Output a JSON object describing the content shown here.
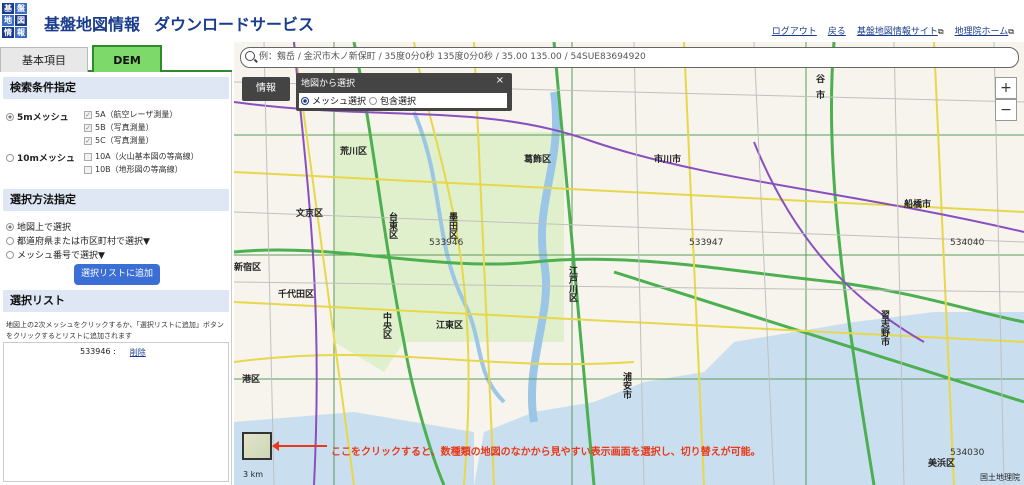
{
  "header": {
    "logo_cells": [
      "基",
      "盤",
      "地",
      "図",
      "情",
      "報"
    ],
    "title": "基盤地図情報",
    "subtitle": "ダウンロードサービス",
    "links": [
      {
        "label": "ログアウト"
      },
      {
        "label": "戻る"
      },
      {
        "label": "基盤地図情報サイト",
        "external": true
      },
      {
        "label": "地理院ホーム",
        "external": true
      }
    ]
  },
  "tabs": [
    {
      "label": "基本項目",
      "active": false
    },
    {
      "label": "DEM",
      "active": true
    }
  ],
  "search_conditions": {
    "heading": "検索条件指定",
    "mesh_5m": {
      "label": "5mメッシュ",
      "selected": true,
      "options": [
        {
          "label": "5A（航空レーザ測量）",
          "checked": true
        },
        {
          "label": "5B（写真測量）",
          "checked": true
        },
        {
          "label": "5C（写真測量）",
          "checked": true
        }
      ]
    },
    "mesh_10m": {
      "label": "10mメッシュ",
      "selected": false,
      "options": [
        {
          "label": "10A（火山基本図の等高線）",
          "checked": false
        },
        {
          "label": "10B（地形図の等高線）",
          "checked": false
        }
      ]
    }
  },
  "selection_method": {
    "heading": "選択方法指定",
    "options": [
      {
        "label": "地図上で選択",
        "selected": true
      },
      {
        "label": "都道府県または市区町村で選択▼",
        "selected": false
      },
      {
        "label": "メッシュ番号で選択▼",
        "selected": false
      }
    ],
    "add_button": "選択リストに追加"
  },
  "selection_list": {
    "heading": "選択リスト",
    "description": "地図上の2次メッシュをクリックするか、「選択リストに追加」ボタンをクリックするとリストに追加されます",
    "items": [
      {
        "code": "533946 :",
        "action": "削除"
      }
    ]
  },
  "map": {
    "search_placeholder": "例：剱岳 / 金沢市木ノ新保町 / 35度0分0秒 135度0分0秒 / 35.00 135.00 / 54SUE83694920",
    "info_button": "情報",
    "select_panel": {
      "title": "地図から選択",
      "close": "×",
      "option_mesh": "メッシュ選択",
      "option_include": "包含選択",
      "selected": "mesh"
    },
    "zoom_in": "+",
    "zoom_out": "−",
    "scale": "3 km",
    "credit": "国土地理院",
    "annotation": "ここをクリックすると、数種類の地図のなかから見やすい表示画面を選択し、切り替えが可能。",
    "mesh_codes": [
      "533946",
      "533947",
      "534040",
      "534030"
    ],
    "place_labels": [
      {
        "text": "荒川区"
      },
      {
        "text": "文京区"
      },
      {
        "text": "台東区"
      },
      {
        "text": "墨田区"
      },
      {
        "text": "葛飾区"
      },
      {
        "text": "新宿区"
      },
      {
        "text": "千代田区"
      },
      {
        "text": "中央区"
      },
      {
        "text": "江東区"
      },
      {
        "text": "江戸川区"
      },
      {
        "text": "港区"
      },
      {
        "text": "市川市"
      },
      {
        "text": "浦安市"
      },
      {
        "text": "船橋市"
      },
      {
        "text": "習志野市"
      },
      {
        "text": "美浜区"
      },
      {
        "text": "谷"
      },
      {
        "text": "市"
      }
    ]
  }
}
